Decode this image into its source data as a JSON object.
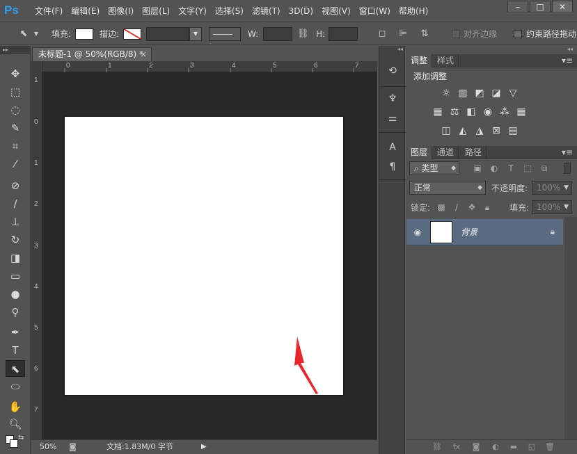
{
  "app": {
    "logo": "Ps",
    "menu": [
      "文件(F)",
      "编辑(E)",
      "图像(I)",
      "图层(L)",
      "文字(Y)",
      "选择(S)",
      "滤镜(T)",
      "3D(D)",
      "视图(V)",
      "窗口(W)",
      "帮助(H)"
    ],
    "window_controls": {
      "minimize": "–",
      "maximize": "□",
      "close": "✕"
    }
  },
  "options_bar": {
    "fill_label": "填充:",
    "stroke_label": "描边:",
    "w_label": "W:",
    "h_label": "H:",
    "align_edges_label": "对齐边缘",
    "constrain_path_label": "约束路径拖动"
  },
  "document": {
    "tab_title": "未标题-1 @ 50%(RGB/8) *",
    "tab_close": "×",
    "ruler_h_labels": [
      "0",
      "1",
      "2",
      "3",
      "4",
      "5",
      "6",
      "7"
    ],
    "ruler_v_labels": [
      "1",
      "0",
      "1",
      "2",
      "3",
      "4",
      "5",
      "6",
      "7"
    ],
    "zoom": "50%",
    "doc_info": "文档:1.83M/0 字节"
  },
  "adjustments_panel": {
    "tabs": [
      "调整",
      "样式"
    ],
    "title": "添加调整"
  },
  "layers_panel": {
    "tabs": [
      "图层",
      "通道",
      "路径"
    ],
    "filter_kind": "类型",
    "blend_mode": "正常",
    "opacity_label": "不透明度:",
    "opacity_value": "100%",
    "lock_label": "锁定:",
    "fill_label": "填充:",
    "fill_value": "100%",
    "layers": [
      {
        "name": "背景",
        "visible": true,
        "locked": true
      }
    ]
  },
  "icons": {
    "tools": [
      "move-icon",
      "marquee-icon",
      "lasso-icon",
      "quick-select-icon",
      "crop-icon",
      "eyedropper-icon",
      "healing-brush-icon",
      "brush-icon",
      "clone-stamp-icon",
      "history-brush-icon",
      "eraser-icon",
      "gradient-icon",
      "blur-icon",
      "dodge-icon",
      "pen-icon",
      "type-icon",
      "path-select-icon",
      "ellipse-icon",
      "hand-icon",
      "zoom-icon"
    ]
  },
  "colors": {
    "accent_logo": "#2fa3f0",
    "canvas": "#ffffff",
    "selected_layer": "#5a6b82",
    "annotation_arrow": "#e8262c"
  }
}
